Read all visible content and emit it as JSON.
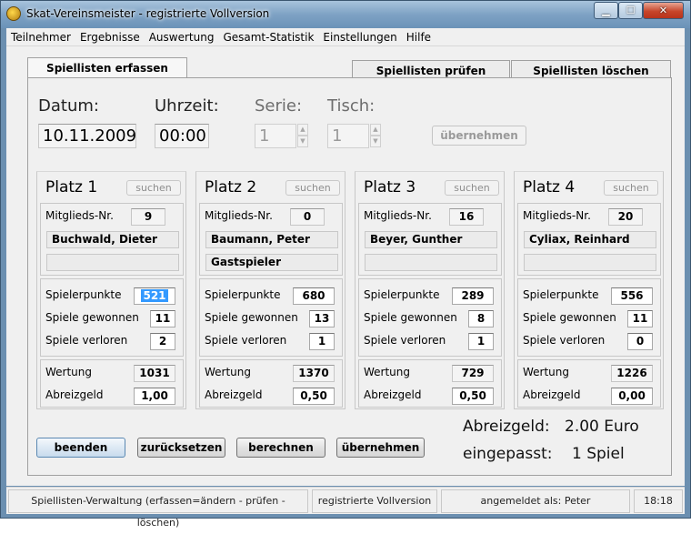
{
  "window": {
    "title": "Skat-Vereinsmeister - registrierte Vollversion"
  },
  "menu": [
    "Teilnehmer",
    "Ergebnisse",
    "Auswertung",
    "Gesamt-Statistik",
    "Einstellungen",
    "Hilfe"
  ],
  "tabs": {
    "active": "Spiellisten erfassen",
    "pruefen": "Spiellisten prüfen",
    "loeschen": "Spiellisten löschen"
  },
  "header": {
    "datum_label": "Datum:",
    "datum": "10.11.2009",
    "uhrzeit_label": "Uhrzeit:",
    "uhrzeit": "00:00",
    "serie_label": "Serie:",
    "serie": "1",
    "tisch_label": "Tisch:",
    "tisch": "1",
    "uebernehmen": "übernehmen"
  },
  "labels": {
    "suchen": "suchen",
    "mitglieds_nr": "Mitglieds-Nr.",
    "spielerpunkte": "Spielerpunkte",
    "spiele_gewonnen": "Spiele gewonnen",
    "spiele_verloren": "Spiele verloren",
    "wertung": "Wertung",
    "abreizgeld": "Abreizgeld"
  },
  "players": [
    {
      "title": "Platz 1",
      "nr": "9",
      "name": "Buchwald, Dieter",
      "extra": "",
      "punkte": "521",
      "gewonnen": "11",
      "verloren": "2",
      "wertung": "1031",
      "abreizgeld": "1,00"
    },
    {
      "title": "Platz 2",
      "nr": "0",
      "name": "Baumann, Peter",
      "extra": "Gastspieler",
      "punkte": "680",
      "gewonnen": "13",
      "verloren": "1",
      "wertung": "1370",
      "abreizgeld": "0,50"
    },
    {
      "title": "Platz 3",
      "nr": "16",
      "name": "Beyer, Gunther",
      "extra": "",
      "punkte": "289",
      "gewonnen": "8",
      "verloren": "1",
      "wertung": "729",
      "abreizgeld": "0,50"
    },
    {
      "title": "Platz 4",
      "nr": "20",
      "name": "Cyliax, Reinhard",
      "extra": "",
      "punkte": "556",
      "gewonnen": "11",
      "verloren": "0",
      "wertung": "1226",
      "abreizgeld": "0,00"
    }
  ],
  "buttons": {
    "beenden": "beenden",
    "zuruecksetzen": "zurücksetzen",
    "berechnen": "berechnen",
    "uebernehmen": "übernehmen"
  },
  "summary": {
    "abreizgeld_label": "Abreizgeld:",
    "abreizgeld_value": "2.00 Euro",
    "eingepasst_label": "eingepasst:",
    "eingepasst_value": "1 Spiel"
  },
  "status": {
    "mode": "Spiellisten-Verwaltung (erfassen=ändern - prüfen - löschen)",
    "version": "registrierte Vollversion",
    "user": "angemeldet als: Peter",
    "time": "18:18"
  },
  "icons": {
    "app": "skat-app-icon",
    "minimize": "minimize-icon",
    "maximize": "maximize-icon",
    "close": "close-icon"
  }
}
